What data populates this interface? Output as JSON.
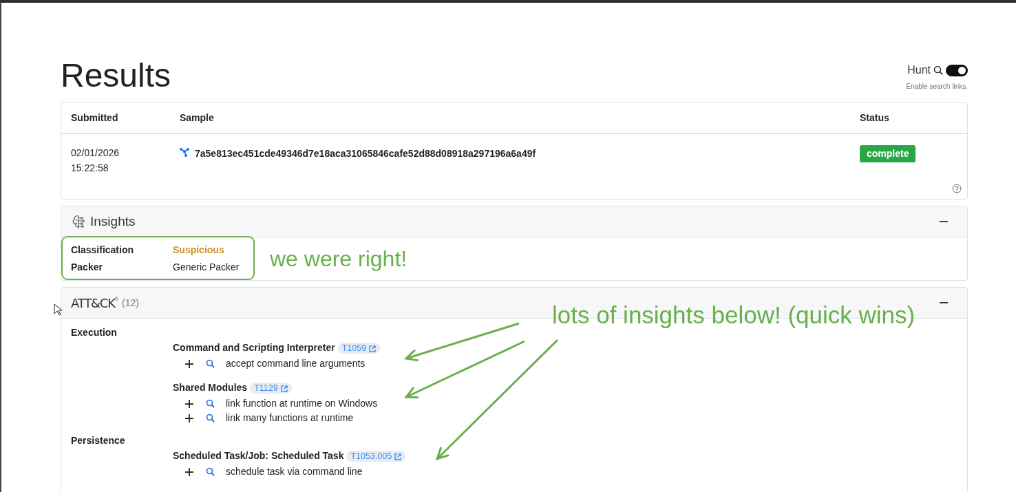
{
  "header": {
    "title": "Results",
    "hunt": {
      "label": "Hunt",
      "on": true,
      "hint": "Enable search links."
    }
  },
  "submissions": {
    "columns": [
      "Submitted",
      "Sample",
      "Status"
    ],
    "rows": [
      {
        "date": "02/01/2026",
        "time": "15:22:58",
        "hash": "7a5e813ec451cde49346d7e18aca31065846cafe52d88d08918a297196a6a49f",
        "status": "complete"
      }
    ]
  },
  "insights": {
    "title": "Insights",
    "expanded": true,
    "rows": [
      {
        "label": "Classification",
        "value": "Suspicious",
        "kind": "verdict"
      },
      {
        "label": "Packer",
        "value": "Generic Packer",
        "kind": "plain"
      }
    ]
  },
  "attack": {
    "title": "ATT&CK",
    "mark": "®",
    "count": "(12)",
    "expanded": true,
    "tactics": [
      {
        "name": "Execution",
        "techniques": [
          {
            "name": "Command and Scripting Interpreter",
            "id": "T1059",
            "capabilities": [
              "accept command line arguments"
            ]
          },
          {
            "name": "Shared Modules",
            "id": "T1129",
            "capabilities": [
              "link function at runtime on Windows",
              "link many functions at runtime"
            ]
          }
        ]
      },
      {
        "name": "Persistence",
        "techniques": [
          {
            "name": "Scheduled Task/Job: Scheduled Task",
            "id": "T1053.005",
            "capabilities": [
              "schedule task via command line"
            ]
          }
        ]
      }
    ]
  },
  "annotations": [
    {
      "text": "we were right!"
    },
    {
      "text": "lots of insights below! (quick wins)"
    }
  ]
}
